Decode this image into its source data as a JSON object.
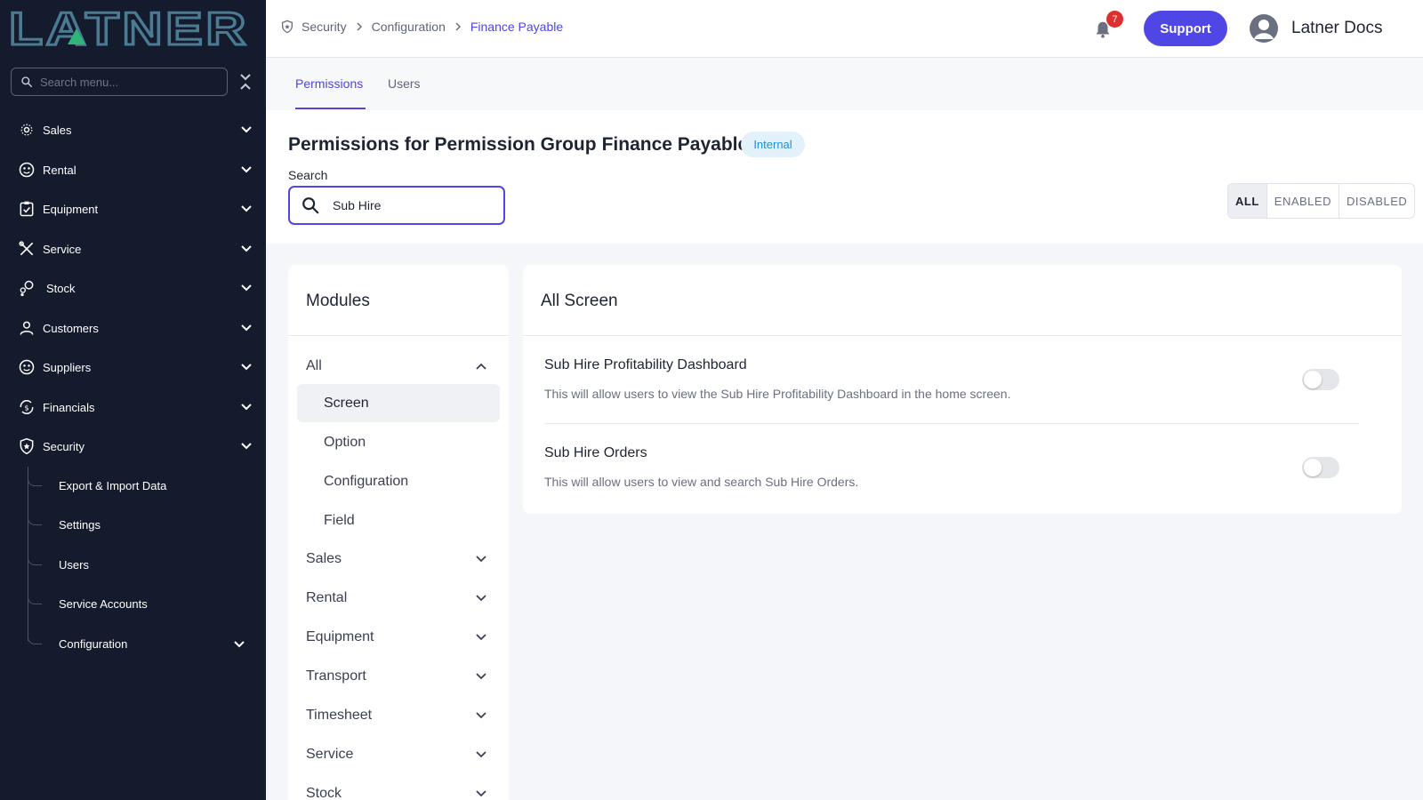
{
  "app": {
    "logo_text": "LATNER",
    "colors": {
      "accent": "#4f46e5",
      "sidebar_bg": "#141b2d",
      "badge_red": "#dc2f2f",
      "internal_badge": "#1f8ed8"
    }
  },
  "sidebar": {
    "search_placeholder": "Search menu...",
    "items": [
      {
        "label": "Sales",
        "icon": "sales-icon"
      },
      {
        "label": "Rental",
        "icon": "rental-icon"
      },
      {
        "label": "Equipment",
        "icon": "equipment-icon"
      },
      {
        "label": "Service",
        "icon": "service-icon"
      },
      {
        "label": "Stock",
        "icon": "stock-icon"
      },
      {
        "label": "Customers",
        "icon": "customers-icon"
      },
      {
        "label": "Suppliers",
        "icon": "suppliers-icon"
      },
      {
        "label": "Financials",
        "icon": "financials-icon"
      },
      {
        "label": "Security",
        "icon": "security-icon"
      }
    ],
    "security_children": [
      {
        "label": "Export & Import Data"
      },
      {
        "label": "Settings"
      },
      {
        "label": "Users"
      },
      {
        "label": "Service Accounts"
      },
      {
        "label": "Configuration"
      }
    ]
  },
  "topbar": {
    "breadcrumb": [
      "Security",
      "Configuration",
      "Finance Payable"
    ],
    "notification_count": "7",
    "support_label": "Support",
    "user_name": "Latner Docs"
  },
  "tabs": [
    {
      "label": "Permissions",
      "active": true
    },
    {
      "label": "Users",
      "active": false
    }
  ],
  "header": {
    "title_prefix": "Permissions for Permission Group",
    "group_name": "Finance Payable",
    "badge": "Internal",
    "search_label": "Search",
    "search_value": "Sub Hire",
    "filter_options": [
      "ALL",
      "ENABLED",
      "DISABLED"
    ],
    "filter_selected": "ALL"
  },
  "modules": {
    "title": "Modules",
    "all_label": "All",
    "sub_items": [
      "Screen",
      "Option",
      "Configuration",
      "Field"
    ],
    "selected_sub": "Screen",
    "groups": [
      "Sales",
      "Rental",
      "Equipment",
      "Transport",
      "Timesheet",
      "Service",
      "Stock"
    ]
  },
  "screen_panel": {
    "title": "All Screen",
    "permissions": [
      {
        "title": "Sub Hire Profitability Dashboard",
        "description": "This will allow users to view the Sub Hire Profitability Dashboard in the home screen.",
        "enabled": false
      },
      {
        "title": "Sub Hire Orders",
        "description": "This will allow users to view and search Sub Hire Orders.",
        "enabled": false
      }
    ]
  }
}
